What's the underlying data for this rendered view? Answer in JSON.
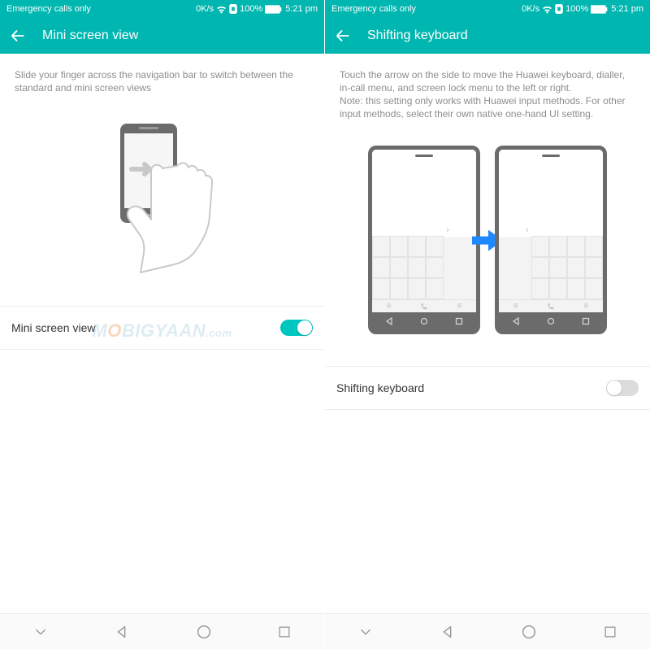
{
  "left": {
    "status": {
      "carrier": "Emergency calls only",
      "speed": "0K/s",
      "battery_pct": "100%",
      "time": "5:21 pm"
    },
    "appbar": {
      "title": "Mini screen view"
    },
    "help": "Slide your finger across the navigation bar to switch between the standard and mini screen views",
    "setting": {
      "label": "Mini screen view",
      "state": "on"
    }
  },
  "right": {
    "status": {
      "carrier": "Emergency calls only",
      "speed": "0K/s",
      "battery_pct": "100%",
      "time": "5:21 pm"
    },
    "appbar": {
      "title": "Shifting keyboard"
    },
    "help": "Touch the arrow on the side to move the Huawei keyboard, dialler, in-call menu, and screen lock menu to the left or right.\nNote: this setting only works with Huawei input methods. For other input methods, select their own native one-hand UI setting.",
    "setting": {
      "label": "Shifting keyboard",
      "state": "off"
    }
  },
  "watermark": "MOBIGYAAN.com",
  "colors": {
    "accent": "#00b6b0"
  }
}
